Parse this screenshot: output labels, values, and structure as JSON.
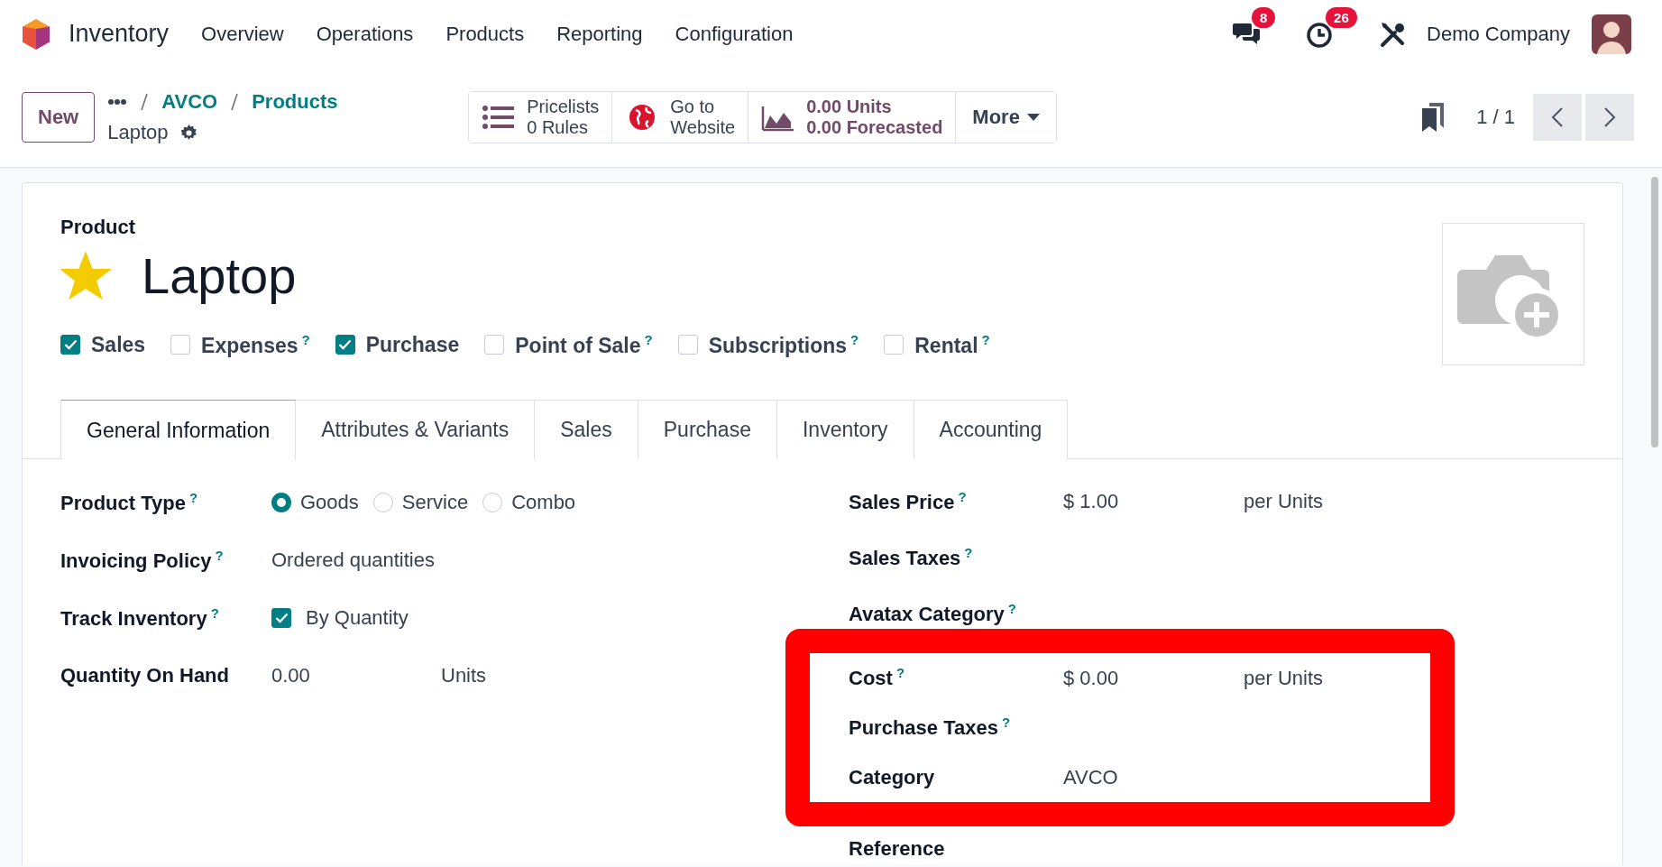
{
  "navbar": {
    "app_name": "Inventory",
    "menu": [
      "Overview",
      "Operations",
      "Products",
      "Reporting",
      "Configuration"
    ],
    "messages_count": "8",
    "activities_count": "26",
    "company": "Demo Company"
  },
  "control_panel": {
    "new_button": "New",
    "breadcrumbs": [
      "AVCO",
      "Products"
    ],
    "record_name": "Laptop",
    "smart_buttons": [
      {
        "kind": "list",
        "lines": [
          "Pricelists",
          "0 Rules"
        ]
      },
      {
        "kind": "globe",
        "lines": [
          "Go to",
          "Website"
        ]
      },
      {
        "kind": "chart",
        "lines": [
          "0.00 Units",
          "0.00 Forecasted"
        ]
      }
    ],
    "more_button": "More",
    "pager": "1 / 1"
  },
  "form": {
    "record_type": "Product",
    "name": "Laptop",
    "favorite": true,
    "options": [
      {
        "label": "Sales",
        "checked": true
      },
      {
        "label": "Expenses",
        "checked": false,
        "help": "?"
      },
      {
        "label": "Purchase",
        "checked": true
      },
      {
        "label": "Point of Sale",
        "checked": false,
        "help": "?"
      },
      {
        "label": "Subscriptions",
        "checked": false,
        "help": "?"
      },
      {
        "label": "Rental",
        "checked": false,
        "help": "?"
      }
    ],
    "tabs": [
      {
        "label": "General Information",
        "selected": true
      },
      {
        "label": "Attributes & Variants",
        "selected": false
      },
      {
        "label": "Sales",
        "selected": false
      },
      {
        "label": "Purchase",
        "selected": false
      },
      {
        "label": "Inventory",
        "selected": false
      },
      {
        "label": "Accounting",
        "selected": false
      }
    ],
    "left_fields": [
      {
        "label": "Product Type",
        "help": "?",
        "kind": "radio",
        "options": [
          {
            "label": "Goods",
            "selected": true
          },
          {
            "label": "Service",
            "selected": false
          },
          {
            "label": "Combo",
            "selected": false
          }
        ]
      },
      {
        "label": "Invoicing Policy",
        "help": "?",
        "kind": "text",
        "value": "Ordered quantities"
      },
      {
        "label": "Track Inventory",
        "help": "?",
        "kind": "checkbox",
        "checked": true,
        "value": "By Quantity"
      },
      {
        "label": "Quantity On Hand",
        "kind": "value_unit",
        "value": "0.00",
        "unit": "Units"
      }
    ],
    "right_fields": [
      {
        "label": "Sales Price",
        "help": "?",
        "kind": "value_unit",
        "value": "$ 1.00",
        "unit": "per Units",
        "highlighted": false
      },
      {
        "label": "Sales Taxes",
        "help": "?",
        "kind": "empty",
        "highlighted": false
      },
      {
        "label": "Avatax Category",
        "help": "?",
        "kind": "empty",
        "highlighted": false
      },
      {
        "label": "Cost",
        "help": "?",
        "kind": "value_unit",
        "value": "$ 0.00",
        "unit": "per Units",
        "highlighted": true
      },
      {
        "label": "Purchase Taxes",
        "help": "?",
        "kind": "empty",
        "highlighted": true
      },
      {
        "label": "Category",
        "kind": "text",
        "value": "AVCO",
        "highlighted": true
      },
      {
        "label": "Reference",
        "kind": "empty",
        "highlighted": false
      }
    ]
  }
}
